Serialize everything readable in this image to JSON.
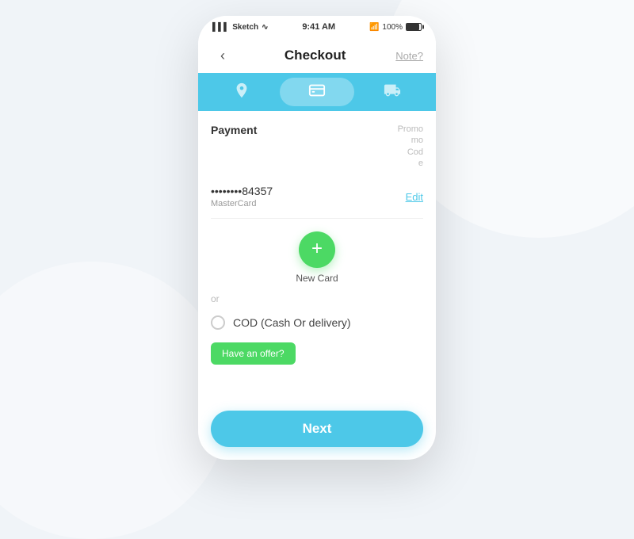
{
  "statusBar": {
    "carrier": "Sketch",
    "wifi": "wifi",
    "time": "9:41 AM",
    "bluetooth": "100%"
  },
  "header": {
    "backIcon": "‹",
    "title": "Checkout",
    "noteLabel": "Note?"
  },
  "steps": [
    {
      "icon": "📍",
      "active": false
    },
    {
      "icon": "💳",
      "active": true
    },
    {
      "icon": "🚚",
      "active": false
    }
  ],
  "payment": {
    "sectionTitle": "Payment",
    "promoLabel": "Promo\nCode",
    "cardNumber": "••••••••84357",
    "cardType": "MasterCard",
    "editLabel": "Edit"
  },
  "newCard": {
    "plusIcon": "+",
    "label": "New Card"
  },
  "orText": "or",
  "cod": {
    "label": "COD  (Cash Or delivery)"
  },
  "offer": {
    "label": "Have an offer?"
  },
  "nextButton": {
    "label": "Next"
  }
}
